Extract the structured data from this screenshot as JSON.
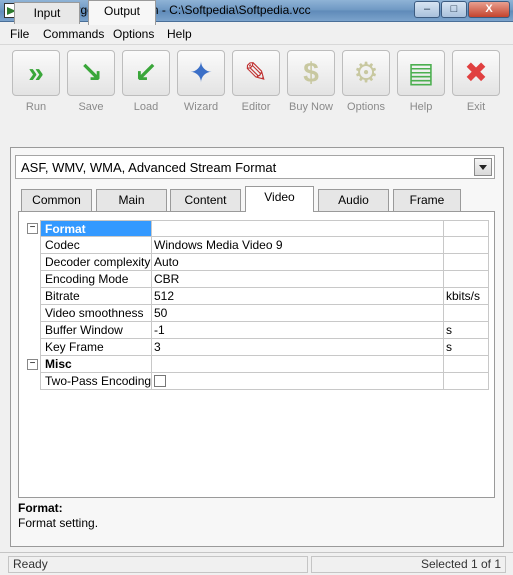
{
  "window": {
    "title": "VideoCharge Full version - C:\\Softpedia\\Softpedia.vcc",
    "min_label": "–",
    "max_label": "□",
    "close_label": "X"
  },
  "menu": [
    "File",
    "Commands",
    "Options",
    "Help"
  ],
  "toolbar": [
    {
      "label": "Run",
      "icon": "run-arrows-icon",
      "glyph": "»",
      "color": "#3aa63a"
    },
    {
      "label": "Save",
      "icon": "save-icon",
      "glyph": "↘",
      "color": "#3aa63a"
    },
    {
      "label": "Load",
      "icon": "load-icon",
      "glyph": "↙",
      "color": "#3aa63a"
    },
    {
      "label": "Wizard",
      "icon": "wizard-wand-icon",
      "glyph": "✦",
      "color": "#3b6fc7"
    },
    {
      "label": "Editor",
      "icon": "editor-film-icon",
      "glyph": "✎",
      "color": "#c03030"
    },
    {
      "label": "Buy Now",
      "icon": "dollar-icon",
      "glyph": "$",
      "color": "#c8c8a0"
    },
    {
      "label": "Options",
      "icon": "gear-icon",
      "glyph": "⚙",
      "color": "#c8c8a0"
    },
    {
      "label": "Help",
      "icon": "help-book-icon",
      "glyph": "▤",
      "color": "#4caf50"
    },
    {
      "label": "Exit",
      "icon": "exit-x-icon",
      "glyph": "✖",
      "color": "#e04040"
    }
  ],
  "outer_tabs": [
    {
      "label": "Input",
      "active": false
    },
    {
      "label": "Output",
      "active": true
    }
  ],
  "format_select": {
    "value": "ASF, WMV, WMA, Advanced Stream Format"
  },
  "inner_tabs": [
    {
      "label": "Common",
      "active": false
    },
    {
      "label": "Main",
      "active": false
    },
    {
      "label": "Content",
      "active": false
    },
    {
      "label": "Video",
      "active": true
    },
    {
      "label": "Audio",
      "active": false
    },
    {
      "label": "Frame",
      "active": false
    }
  ],
  "properties": [
    {
      "type": "category",
      "name": "Format",
      "toggle": "−",
      "selected": true
    },
    {
      "type": "prop",
      "name": "Codec",
      "value": "Windows Media Video 9",
      "unit": ""
    },
    {
      "type": "prop",
      "name": "Decoder complexity",
      "value": "Auto",
      "unit": ""
    },
    {
      "type": "prop",
      "name": "Encoding Mode",
      "value": "CBR",
      "unit": ""
    },
    {
      "type": "prop",
      "name": "Bitrate",
      "value": "512",
      "unit": "kbits/s"
    },
    {
      "type": "prop",
      "name": "Video smoothness",
      "value": "50",
      "unit": ""
    },
    {
      "type": "prop",
      "name": "Buffer Window",
      "value": "-1",
      "unit": "s"
    },
    {
      "type": "prop",
      "name": "Key Frame",
      "value": "3",
      "unit": "s"
    },
    {
      "type": "category",
      "name": "Misc",
      "toggle": "−",
      "selected": false
    },
    {
      "type": "checkbox",
      "name": "Two-Pass Encoding",
      "checked": false,
      "unit": ""
    }
  ],
  "description": {
    "title": "Format:",
    "text": "Format setting."
  },
  "status": {
    "left": "Ready",
    "right": "Selected 1 of 1"
  }
}
